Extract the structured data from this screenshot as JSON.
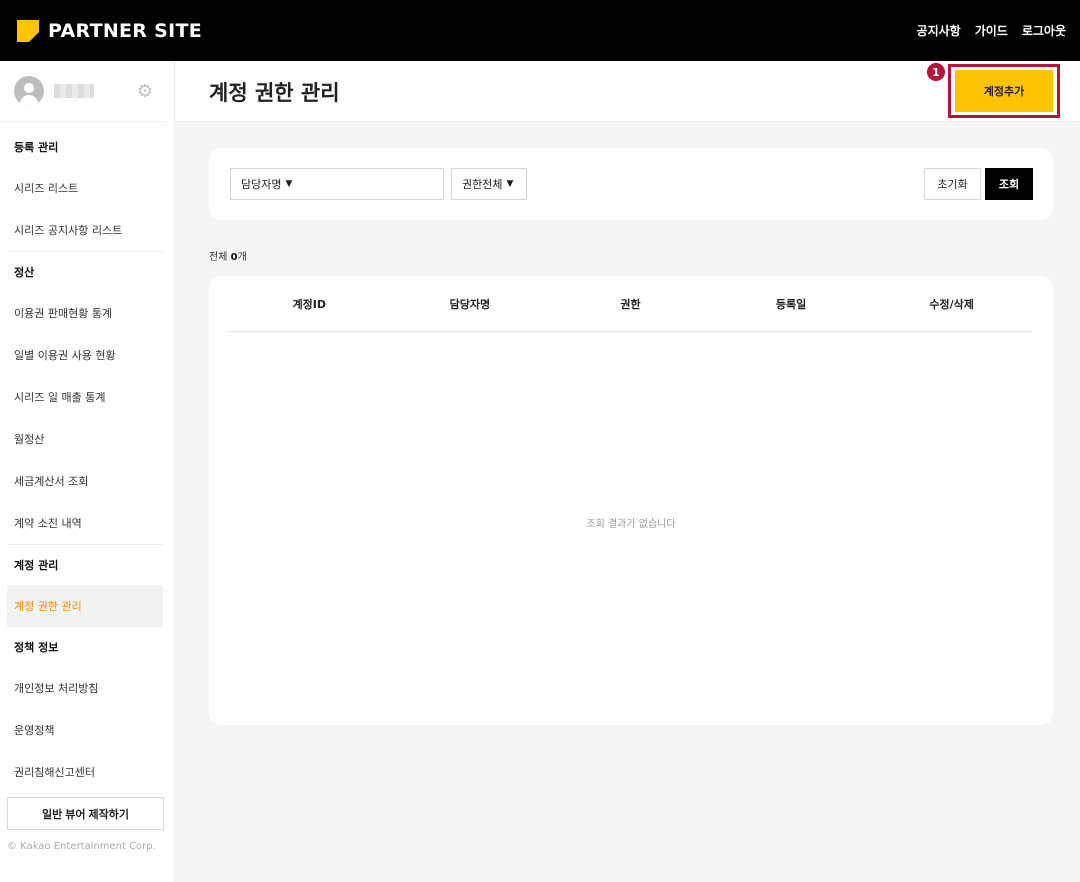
{
  "header": {
    "brand": "PARTNER SITE",
    "nav": [
      "공지사항",
      "가이드",
      "로그아웃"
    ]
  },
  "sidebar": {
    "sections": [
      {
        "title": "등록 관리",
        "items": [
          "시리즈 리스트",
          "시리즈 공지사항 리스트"
        ]
      },
      {
        "title": "정산",
        "items": [
          "이용권 판매현황 통계",
          "일별 이용권 사용 현황",
          "시리즈 일 매출 통계",
          "월정산",
          "세금계산서 조회",
          "계약 소진 내역"
        ]
      },
      {
        "title": "계정 관리",
        "items": [
          "계정 권한 관리"
        ]
      },
      {
        "title": "정책 정보",
        "items": [
          "개인정보 처리방침",
          "운영정책",
          "권리침해신고센터"
        ]
      }
    ],
    "active_item": "계정 권한 관리",
    "viewer_button": "일반 뷰어 제작하기",
    "copyright": "© Kakao Entertainment Corp."
  },
  "main": {
    "title": "계정 권한 관리",
    "add_button": "계정추가",
    "badge": "1",
    "filters": {
      "manager_select": "담당자명",
      "permission_select": "권한전체",
      "reset_button": "초기화",
      "search_button": "조회"
    },
    "count_label": "전체",
    "count_value": "0",
    "count_unit": "개",
    "table": {
      "columns": [
        "계정ID",
        "담당자명",
        "권한",
        "등록일",
        "수정/삭제"
      ],
      "empty_message": "조회 결과가 없습니다"
    }
  },
  "colors": {
    "accent": "#ffc300",
    "highlight": "#b3163a",
    "active_nav": "#f08a00"
  }
}
